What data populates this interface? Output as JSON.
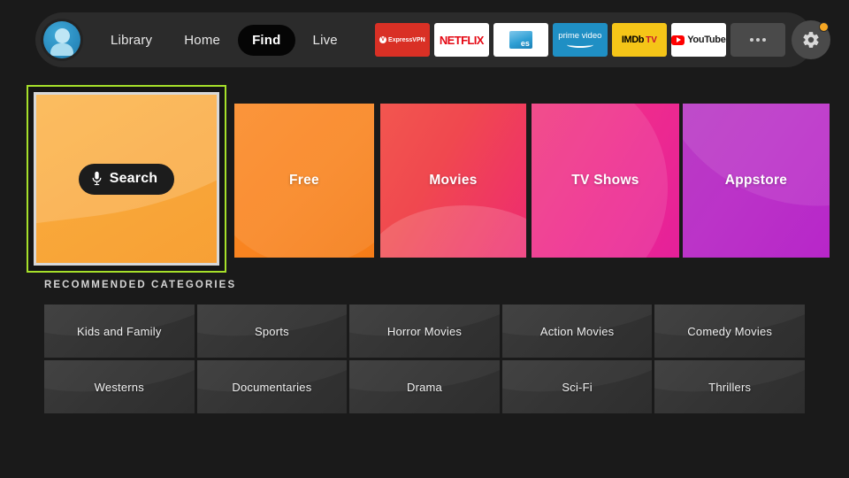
{
  "nav": {
    "avatar_label": "profile",
    "links": [
      {
        "label": "Library",
        "active": false
      },
      {
        "label": "Home",
        "active": false
      },
      {
        "label": "Find",
        "active": true
      },
      {
        "label": "Live",
        "active": false
      }
    ],
    "apps": [
      {
        "name": "ExpressVPN",
        "text": "ExpressVPN"
      },
      {
        "name": "Netflix",
        "text": "NETFLIX"
      },
      {
        "name": "ES File Explorer",
        "text": "es"
      },
      {
        "name": "Prime Video",
        "text": "prime video"
      },
      {
        "name": "IMDb TV",
        "text": "IMDb",
        "text2": "TV"
      },
      {
        "name": "YouTube",
        "text": "YouTube"
      }
    ],
    "more_label": "More apps",
    "settings_label": "Settings"
  },
  "tiles": {
    "search": {
      "label": "Search",
      "icon": "microphone-icon"
    },
    "items": [
      {
        "label": "Free"
      },
      {
        "label": "Movies"
      },
      {
        "label": "TV Shows"
      },
      {
        "label": "Appstore"
      }
    ]
  },
  "recommended": {
    "heading": "RECOMMENDED CATEGORIES",
    "categories": [
      "Kids and Family",
      "Sports",
      "Horror Movies",
      "Action Movies",
      "Comedy Movies",
      "Westerns",
      "Documentaries",
      "Drama",
      "Sci-Fi",
      "Thrillers"
    ]
  },
  "colors": {
    "background": "#1a1a1a",
    "navbar": "#2b2b2b",
    "focus_ring": "#a6e02a",
    "badge": "#f5a623"
  }
}
